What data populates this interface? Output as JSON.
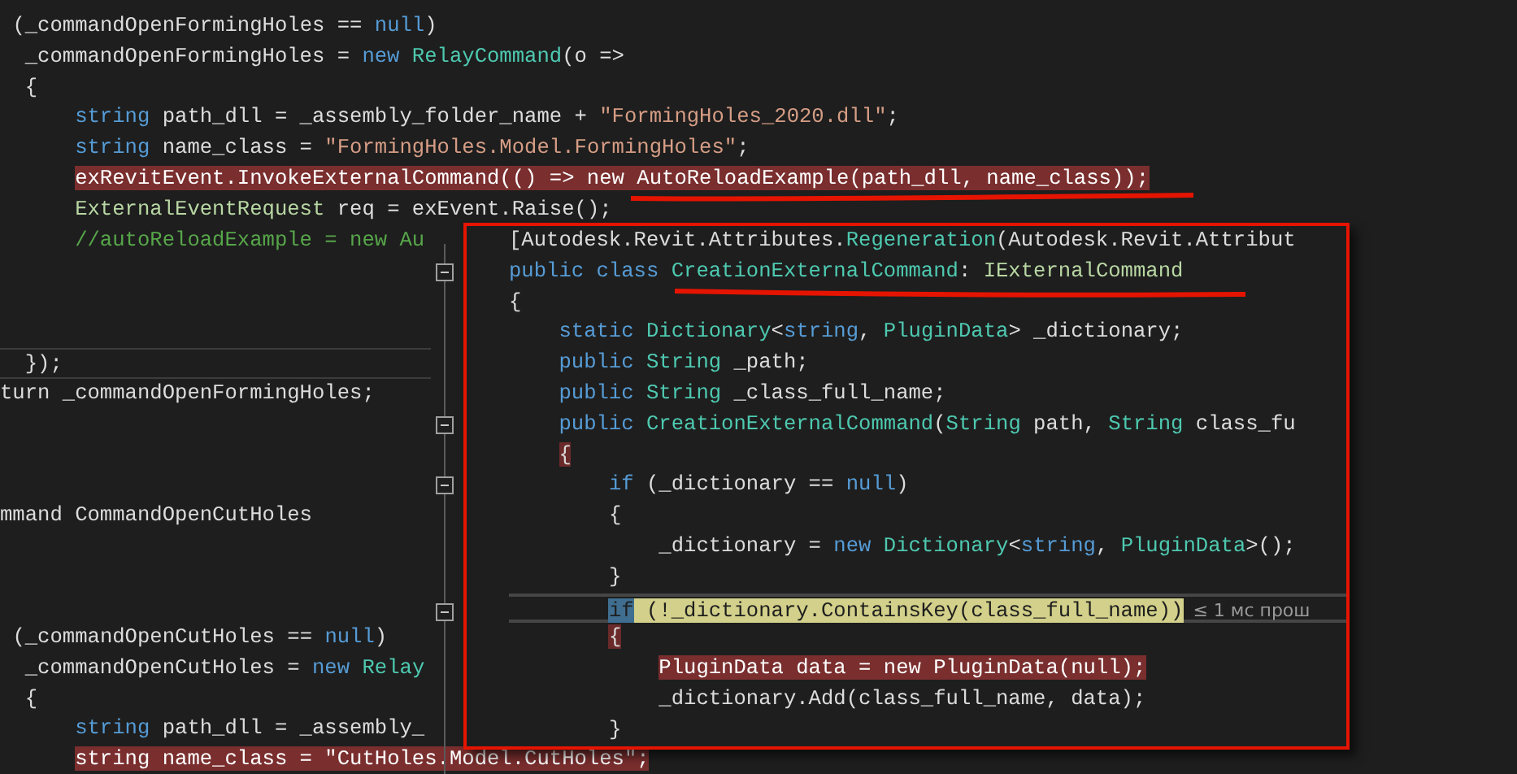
{
  "editor": {
    "lines": [
      {
        "tokens": [
          {
            "text": " (_commandOpenFormingHoles == ",
            "kind": "plain"
          },
          {
            "text": "null",
            "kind": "keyword"
          },
          {
            "text": ")",
            "kind": "plain"
          }
        ]
      },
      {
        "tokens": [
          {
            "text": "  _commandOpenFormingHoles = ",
            "kind": "plain"
          },
          {
            "text": "new",
            "kind": "keyword"
          },
          {
            "text": " RelayCommand",
            "kind": "type"
          },
          {
            "text": "(o =>",
            "kind": "plain"
          }
        ]
      },
      {
        "tokens": [
          {
            "text": "  {",
            "kind": "plain"
          }
        ]
      },
      {
        "tokens": [
          {
            "text": "      string",
            "kind": "keyword"
          },
          {
            "text": " path_dll = _assembly_folder_name + ",
            "kind": "plain"
          },
          {
            "text": "\"FormingHoles_2020.dll\"",
            "kind": "string"
          },
          {
            "text": ";",
            "kind": "plain"
          }
        ]
      },
      {
        "tokens": [
          {
            "text": "      string",
            "kind": "keyword"
          },
          {
            "text": " name_class = ",
            "kind": "plain"
          },
          {
            "text": "\"FormingHoles.Model.FormingHoles\"",
            "kind": "string"
          },
          {
            "text": ";",
            "kind": "plain"
          }
        ]
      },
      {
        "tokens": [
          {
            "text": "      exRevitEvent.InvokeExternalCommand(() => new AutoReloadExample(path_dll, name_class));",
            "kind": "plain",
            "breakpoint": true
          }
        ]
      },
      {
        "tokens": [
          {
            "text": "      ExternalEventRequest",
            "kind": "interface"
          },
          {
            "text": " req = exEvent.Raise();",
            "kind": "plain"
          }
        ]
      },
      {
        "tokens": [
          {
            "text": "      //autoReloadExample = new Au",
            "kind": "comment"
          }
        ]
      },
      {
        "blank": true
      },
      {
        "blank": true
      },
      {
        "blank": true
      },
      {
        "separator": true,
        "tokens": [
          {
            "text": "  });",
            "kind": "plain"
          }
        ]
      },
      {
        "tokens": [
          {
            "text": "turn _commandOpenFormingHoles;",
            "kind": "plain"
          }
        ]
      },
      {
        "blank": true
      },
      {
        "blank": true
      },
      {
        "blank": true
      },
      {
        "tokens": [
          {
            "text": "mmand CommandOpenCutHoles",
            "kind": "plain"
          }
        ]
      },
      {
        "blank": true
      },
      {
        "blank": true
      },
      {
        "blank": true
      },
      {
        "tokens": [
          {
            "text": " (_commandOpenCutHoles == ",
            "kind": "plain"
          },
          {
            "text": "null",
            "kind": "keyword"
          },
          {
            "text": ")",
            "kind": "plain"
          }
        ]
      },
      {
        "tokens": [
          {
            "text": "  _commandOpenCutHoles = ",
            "kind": "plain"
          },
          {
            "text": "new",
            "kind": "keyword"
          },
          {
            "text": " Relay",
            "kind": "type"
          }
        ]
      },
      {
        "tokens": [
          {
            "text": "  {",
            "kind": "plain"
          }
        ]
      },
      {
        "tokens": [
          {
            "text": "      string",
            "kind": "keyword"
          },
          {
            "text": " path_dll = _assembly_",
            "kind": "plain"
          }
        ]
      },
      {
        "tokens": [
          {
            "text": "      string name_class = \"CutHoles.Model.CutHoles\";",
            "kind": "plain",
            "breakpoint": true
          }
        ]
      }
    ]
  },
  "peek": {
    "lines": [
      {
        "tokens": [
          {
            "text": "[Autodesk.Revit.Attributes.",
            "kind": "plain"
          },
          {
            "text": "Regeneration",
            "kind": "type"
          },
          {
            "text": "(Autodesk.Revit.Attribut",
            "kind": "plain"
          }
        ]
      },
      {
        "fold": {
          "expanded": true
        },
        "tokens": [
          {
            "text": "public",
            "kind": "keyword"
          },
          {
            "text": " class",
            "kind": "keyword"
          },
          {
            "text": " CreationExternalCommand",
            "kind": "type"
          },
          {
            "text": ": ",
            "kind": "plain"
          },
          {
            "text": "IExternalCommand",
            "kind": "interface"
          }
        ]
      },
      {
        "tokens": [
          {
            "text": "{",
            "kind": "plain"
          }
        ]
      },
      {
        "tokens": [
          {
            "text": "    static",
            "kind": "keyword"
          },
          {
            "text": " Dictionary",
            "kind": "type"
          },
          {
            "text": "<",
            "kind": "plain"
          },
          {
            "text": "string",
            "kind": "keyword"
          },
          {
            "text": ", ",
            "kind": "plain"
          },
          {
            "text": "PluginData",
            "kind": "type"
          },
          {
            "text": "> _dictionary;",
            "kind": "plain"
          }
        ]
      },
      {
        "tokens": [
          {
            "text": "    public",
            "kind": "keyword"
          },
          {
            "text": " String",
            "kind": "type"
          },
          {
            "text": " _path;",
            "kind": "plain"
          }
        ]
      },
      {
        "tokens": [
          {
            "text": "    public",
            "kind": "keyword"
          },
          {
            "text": " String",
            "kind": "type"
          },
          {
            "text": " _class_full_name;",
            "kind": "plain"
          }
        ]
      },
      {
        "fold": {
          "expanded": true
        },
        "tokens": [
          {
            "text": "    public",
            "kind": "keyword"
          },
          {
            "text": " CreationExternalCommand",
            "kind": "type"
          },
          {
            "text": "(",
            "kind": "plain"
          },
          {
            "text": "String",
            "kind": "type"
          },
          {
            "text": " path, ",
            "kind": "plain"
          },
          {
            "text": "String",
            "kind": "type"
          },
          {
            "text": " class_fu",
            "kind": "plain"
          }
        ]
      },
      {
        "tokens": [
          {
            "text": "    {",
            "kind": "plain",
            "brace_match": true
          }
        ]
      },
      {
        "fold": {
          "expanded": true
        },
        "tokens": [
          {
            "text": "        if",
            "kind": "keyword"
          },
          {
            "text": " (_dictionary == ",
            "kind": "plain"
          },
          {
            "text": "null",
            "kind": "keyword"
          },
          {
            "text": ")",
            "kind": "plain"
          }
        ]
      },
      {
        "tokens": [
          {
            "text": "        {",
            "kind": "plain"
          }
        ]
      },
      {
        "tokens": [
          {
            "text": "            _dictionary = ",
            "kind": "plain"
          },
          {
            "text": "new",
            "kind": "keyword"
          },
          {
            "text": " Dictionary",
            "kind": "type"
          },
          {
            "text": "<",
            "kind": "plain"
          },
          {
            "text": "string",
            "kind": "keyword"
          },
          {
            "text": ", ",
            "kind": "plain"
          },
          {
            "text": "PluginData",
            "kind": "type"
          },
          {
            "text": ">();",
            "kind": "plain"
          }
        ]
      },
      {
        "tokens": [
          {
            "text": "        }",
            "kind": "plain"
          }
        ]
      },
      {
        "fold": {
          "expanded": true
        },
        "current": true,
        "tip": "≤ 1 мс прош",
        "tokens": [
          {
            "text": "        if",
            "kind": "keyword",
            "selected": true
          },
          {
            "text": " (!_dictionary.ContainsKey(class_full_name))",
            "kind": "plain",
            "match": true
          }
        ]
      },
      {
        "tokens": [
          {
            "text": "        {",
            "kind": "plain",
            "brace_match": true
          }
        ]
      },
      {
        "tokens": [
          {
            "text": "            PluginData data = new PluginData(null);",
            "kind": "plain",
            "breakpoint": true
          }
        ]
      },
      {
        "tokens": [
          {
            "text": "            _dictionary.Add(class_full_name, data);",
            "kind": "plain"
          }
        ]
      },
      {
        "tokens": [
          {
            "text": "        }",
            "kind": "plain"
          }
        ]
      }
    ]
  }
}
